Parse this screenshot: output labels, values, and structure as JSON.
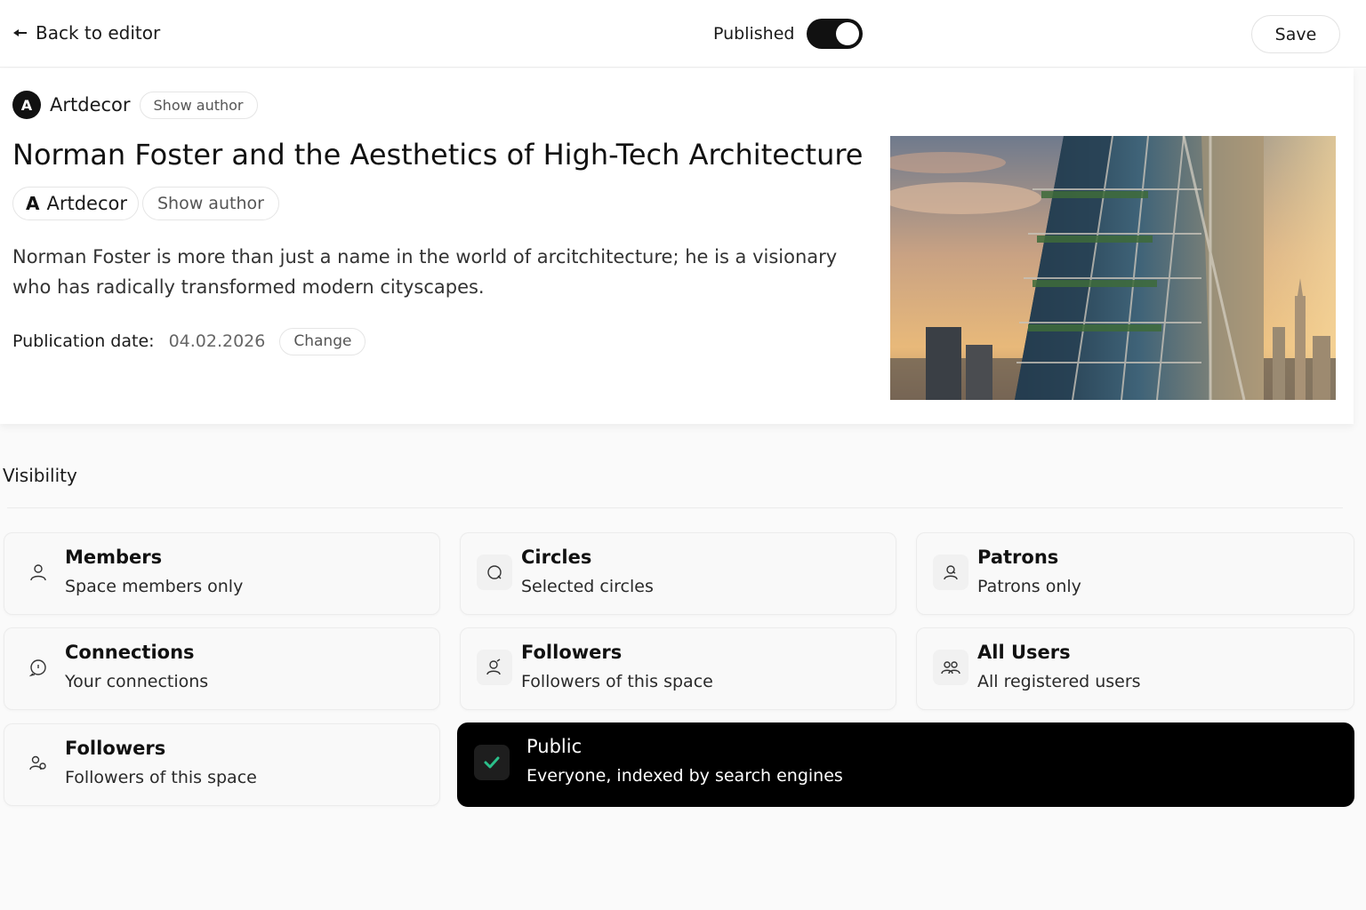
{
  "topbar": {
    "back_label": "Back to editor",
    "published_label": "Published",
    "published_on": true,
    "save_label": "Save"
  },
  "article": {
    "author_initial": "A",
    "author_name": "Artdecor",
    "show_author_label": "Show author",
    "title": "Norman Foster and the Aesthetics of High-Tech Architecture",
    "author_chip_glyph": "A",
    "author_chip_name": "Artdecor",
    "show_author_label2": "Show author",
    "excerpt": "Norman Foster is more than just a name in the world of arcitchitecture; he is a visionary who has radically transformed modern cityscapes.",
    "publication_date_label": "Publication date:",
    "publication_date": "04.02.2026",
    "change_label": "Change"
  },
  "visibility": {
    "title": "Visibility",
    "options": [
      {
        "title": "Members",
        "desc": "Space members only",
        "icon": "user-icon"
      },
      {
        "title": "Circles",
        "desc": "Selected circles",
        "icon": "circle-icon"
      },
      {
        "title": "Patrons",
        "desc": "Patrons only",
        "icon": "patron-icon"
      },
      {
        "title": "Connections",
        "desc": "Your connections",
        "icon": "chat-bubble-icon"
      },
      {
        "title": "Followers",
        "desc": "Followers of this space",
        "icon": "follower-icon"
      },
      {
        "title": "All Users",
        "desc": "All registered users",
        "icon": "users-icon"
      },
      {
        "title": "Followers",
        "desc": "Followers of this space",
        "icon": "followers-icon"
      },
      {
        "title": "Public",
        "desc": "Everyone, indexed by search engines",
        "icon": "check-icon",
        "selected": true
      }
    ]
  },
  "colors": {
    "accent_check": "#2bbf8a",
    "selected_bg": "#000000"
  }
}
